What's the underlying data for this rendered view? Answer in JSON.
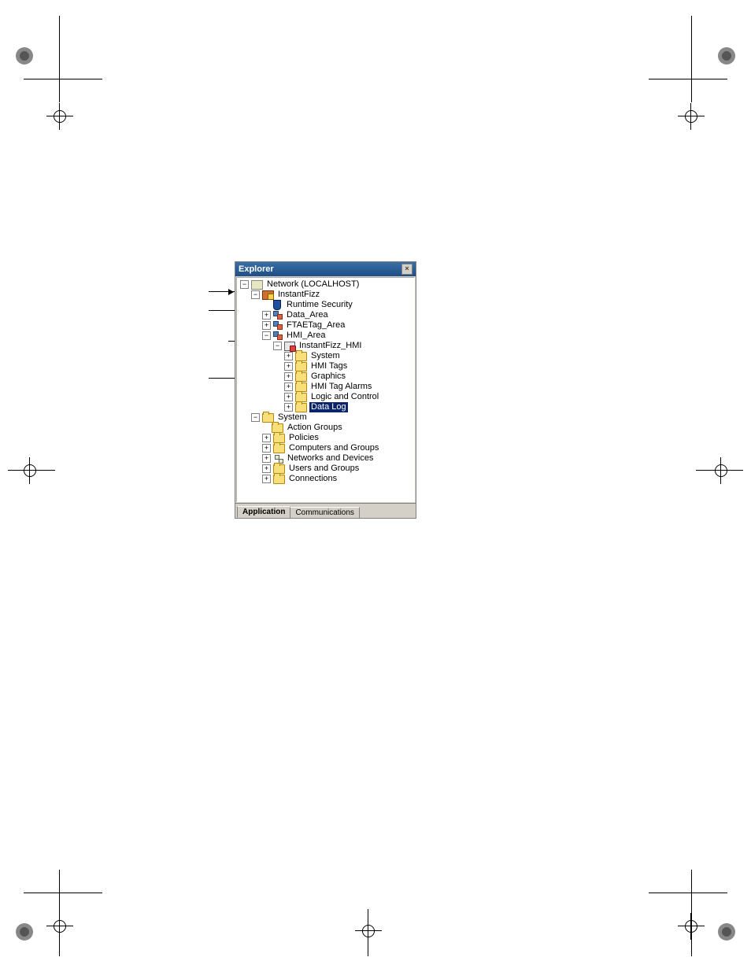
{
  "panel": {
    "title": "Explorer",
    "close_glyph": "×"
  },
  "tree": {
    "root": "Network (LOCALHOST)",
    "app": "InstantFizz",
    "runtime_security": "Runtime Security",
    "data_area": "Data_Area",
    "ftae_area": "FTAETag_Area",
    "hmi_area": "HMI_Area",
    "hmi_server": "InstantFizz_HMI",
    "hmi_children": {
      "system": "System",
      "hmi_tags": "HMI Tags",
      "graphics": "Graphics",
      "hmi_tag_alarms": "HMI Tag Alarms",
      "logic": "Logic and Control",
      "data_log": "Data Log"
    },
    "system": "System",
    "system_children": {
      "action_groups": "Action Groups",
      "policies": "Policies",
      "computers": "Computers and Groups",
      "networks": "Networks and Devices",
      "users": "Users and Groups",
      "connections": "Connections"
    }
  },
  "tabs": {
    "application": "Application",
    "communications": "Communications"
  }
}
